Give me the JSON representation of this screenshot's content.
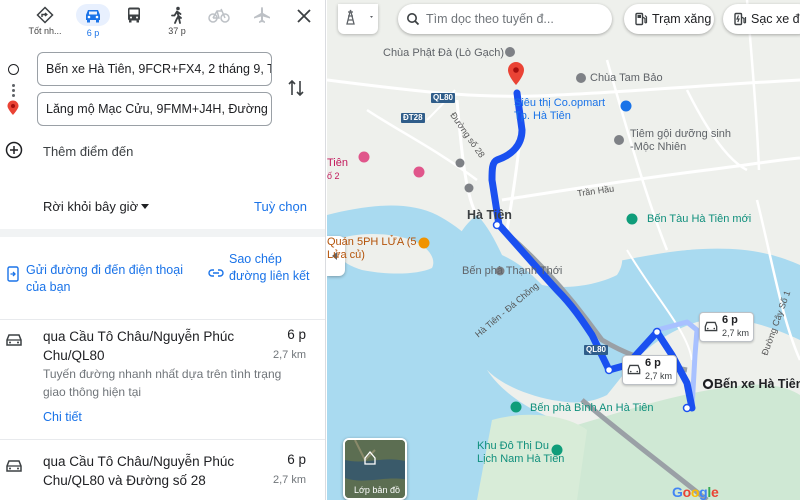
{
  "modes": [
    {
      "id": "best",
      "label": "Tốt nh..."
    },
    {
      "id": "drive",
      "label": "6 p"
    },
    {
      "id": "transit",
      "label": ""
    },
    {
      "id": "walk",
      "label": "37 p"
    },
    {
      "id": "bike",
      "label": ""
    },
    {
      "id": "flight",
      "label": ""
    }
  ],
  "inputs": {
    "origin": "Bến xe Hà Tiên, 9FCR+FX4, 2 tháng 9, Tô",
    "destination": "Lăng mộ Mạc Cửu, 9FMM+J4H, Đường s",
    "add_stop": "Thêm điểm đến"
  },
  "leave": {
    "label": "Rời khỏi bây giờ",
    "options": "Tuỳ chọn"
  },
  "share": {
    "send": "Gửi đường đi đến điện thoại của bạn",
    "copy": "Sao chép đường liên kết"
  },
  "routes": [
    {
      "title": "qua Cầu Tô Châu/Nguyễn Phúc Chu/QL80",
      "time": "6 p",
      "distance": "2,7 km",
      "description": "Tuyến đường nhanh nhất dựa trên tình trạng giao thông hiện tại",
      "details": "Chi tiết"
    },
    {
      "title": "qua Cầu Tô Châu/Nguyễn Phúc Chu/QL80 và Đường số 28",
      "time": "6 p",
      "distance": "2,7 km"
    }
  ],
  "map": {
    "search_placeholder": "Tìm dọc theo tuyến đ...",
    "chips": {
      "gas": "Trạm xăng",
      "charge": "Sạc xe đ"
    },
    "labels": {
      "pagoda": "Chùa Phật Đà (Lò Gạch)",
      "tam_bao": "Chùa Tam Bảo",
      "supermarket": "Siêu thị Co.opmart Tp. Hà Tiên",
      "temple": "Tiêm gội dưỡng sinh -Mộc Nhiên",
      "ha_tien": "Hà Tiên",
      "ferry_port": "Bến Tàu Hà Tiên mới",
      "restaurant": "Quán 5PH LỬA (5 Lửa củ)",
      "ferry_thanh_thoi": "Bến phà Thạnh Thới",
      "ferry_binh_an": "Bến phà Bình An Hà Tiên",
      "khu_do_thi": "Khu Đô Thị Du Lịch Nam Hà Tiên",
      "dest_bus": "Bến xe Hà Tiên",
      "tien_left": "Tiên",
      "so2": "ố 2",
      "tran_hau": "Trần Hầu",
      "duong_so_28": "Đường số 28",
      "ha_tien_da_chong": "Hà Tiên - Đá Chồng",
      "duong_cay_so_1": "Đường Cây Số 1",
      "ql80_a": "QL80",
      "ql80_b": "QL80",
      "dt28": "ĐT28"
    },
    "info_boxes": [
      {
        "time": "6 p",
        "distance": "2,7 km"
      },
      {
        "time": "6 p",
        "distance": "2,7 km"
      }
    ],
    "satellite_label": "Lớp bản đồ",
    "logo": "Google"
  },
  "colors": {
    "route": "#1a50f0",
    "alt_route": "#a8c1ff",
    "water": "#a9daf0",
    "land": "#eef0ec",
    "accent": "#1a73e8"
  }
}
